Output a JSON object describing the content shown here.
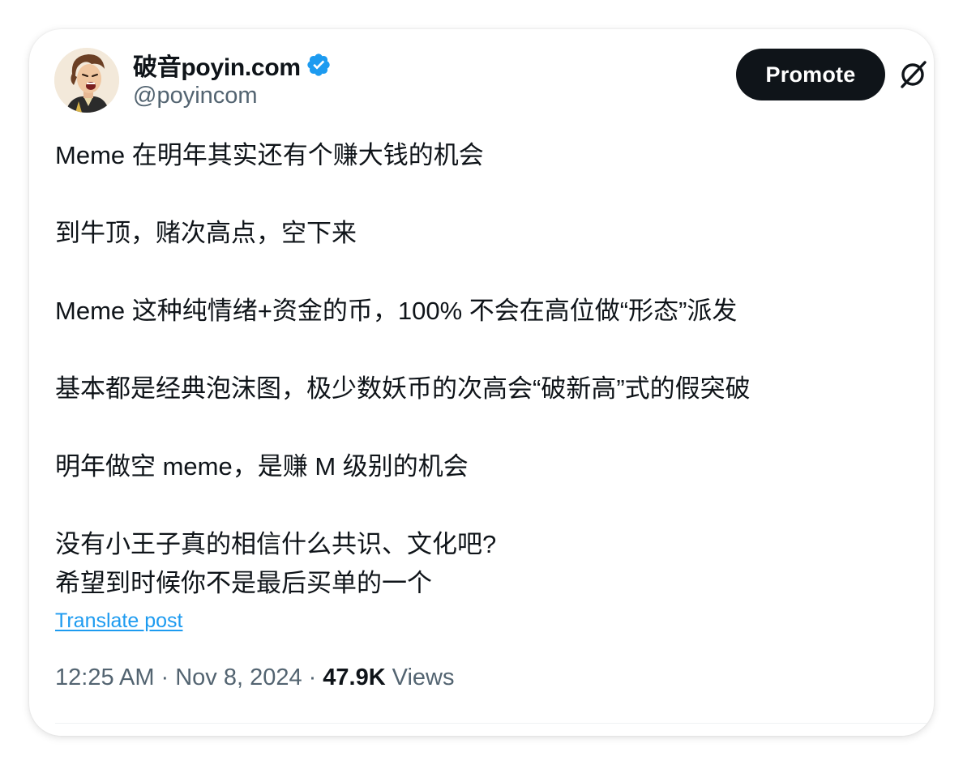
{
  "author": {
    "display_name": "破音poyin.com",
    "handle": "@poyincom",
    "avatar_icon": "avatar-illustration",
    "verified_color": "#1d9bf0"
  },
  "actions": {
    "promote_label": "Promote",
    "grok_icon": "grok-icon"
  },
  "post": {
    "paragraphs": [
      "Meme 在明年其实还有个赚大钱的机会",
      "",
      "到牛顶，赌次高点，空下来",
      "",
      "Meme 这种纯情绪+资金的币，100% 不会在高位做“形态”派发",
      "",
      "基本都是经典泡沫图，极少数妖币的次高会“破新高”式的假突破",
      "",
      "明年做空 meme，是赚 M 级别的机会",
      "",
      "没有小王子真的相信什么共识、文化吧?",
      "希望到时候你不是最后买单的一个"
    ],
    "translate_label": "Translate post"
  },
  "meta": {
    "time": "12:25 AM",
    "separator": "·",
    "date": "Nov 8, 2024",
    "views_count": "47.9K",
    "views_label": "Views"
  },
  "colors": {
    "text_primary": "#0f1419",
    "text_secondary": "#536471",
    "accent": "#1d9bf0",
    "button_bg": "#0f1419"
  }
}
